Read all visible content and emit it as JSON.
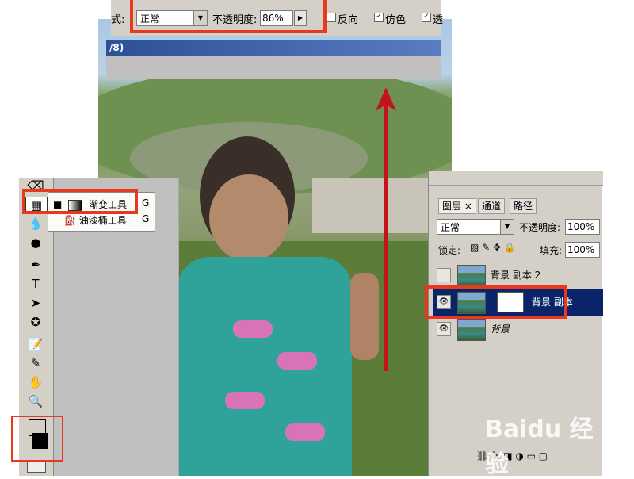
{
  "options_bar": {
    "mode_label": "式:",
    "mode_value": "正常",
    "opacity_label": "不透明度:",
    "opacity_value": "86%",
    "checkboxes": [
      {
        "label": "反向",
        "checked": false
      },
      {
        "label": "仿色",
        "checked": true
      },
      {
        "label": "透",
        "checked": true
      }
    ]
  },
  "document": {
    "title_fragment": "/8)"
  },
  "tool_flyout": {
    "items": [
      {
        "label": "渐变工具",
        "shortcut": "G",
        "active": true
      },
      {
        "label": "油漆桶工具",
        "shortcut": "G",
        "active": false
      }
    ]
  },
  "layers_panel": {
    "tabs": [
      "图层",
      "通道",
      "路径"
    ],
    "tab_close": "×",
    "blend_mode": "正常",
    "opacity_label": "不透明度:",
    "opacity_value": "100%",
    "lock_label": "锁定:",
    "fill_label": "填充:",
    "fill_value": "100%",
    "layers": [
      {
        "name": "背景 副本 2",
        "visible": false,
        "selected": false
      },
      {
        "name": "背景 副本",
        "visible": true,
        "selected": true
      },
      {
        "name": "背景",
        "visible": true,
        "selected": false
      }
    ]
  },
  "watermark": "Baidu 经验",
  "colors": {
    "highlight": "#e8391f",
    "arrow": "#c3141a",
    "selected_row": "#0a246a",
    "title_bar": "#2c4f97"
  }
}
